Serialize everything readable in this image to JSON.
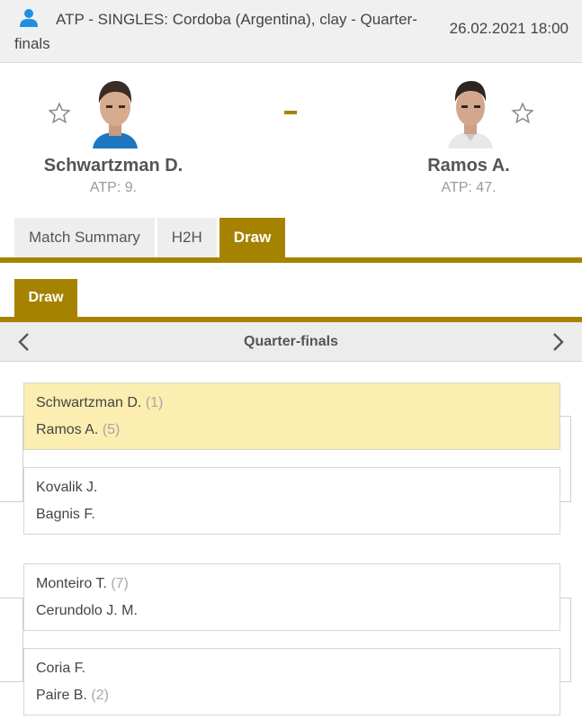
{
  "header": {
    "tournament": "ATP - SINGLES: Cordoba (Argentina), clay - Quarter-finals",
    "datetime": "26.02.2021 18:00"
  },
  "match": {
    "home": {
      "name": "Schwartzman D.",
      "rank": "ATP: 9."
    },
    "away": {
      "name": "Ramos A.",
      "rank": "ATP: 47."
    },
    "separator": "-"
  },
  "tabs": [
    {
      "label": "Match Summary",
      "active": false
    },
    {
      "label": "H2H",
      "active": false
    },
    {
      "label": "Draw",
      "active": true
    }
  ],
  "subtab": {
    "label": "Draw"
  },
  "round": {
    "title": "Quarter-finals"
  },
  "draw": [
    {
      "p1": "Schwartzman D.",
      "s1": "(1)",
      "p2": "Ramos A.",
      "s2": "(5)",
      "highlight": true
    },
    {
      "p1": "Kovalik J.",
      "s1": "",
      "p2": "Bagnis F.",
      "s2": "",
      "highlight": false
    },
    {
      "p1": "Monteiro T.",
      "s1": "(7)",
      "p2": "Cerundolo J. M.",
      "s2": "",
      "highlight": false
    },
    {
      "p1": "Coria F.",
      "s1": "",
      "p2": "Paire B.",
      "s2": "(2)",
      "highlight": false
    }
  ],
  "colors": {
    "accent": "#a58300",
    "highlight": "#fbeeb0",
    "person_icon": "#1f8ee0"
  },
  "icons": {
    "person": "person-icon",
    "favorite": "star-icon",
    "prev": "chevron-left-icon",
    "next": "chevron-right-icon"
  }
}
